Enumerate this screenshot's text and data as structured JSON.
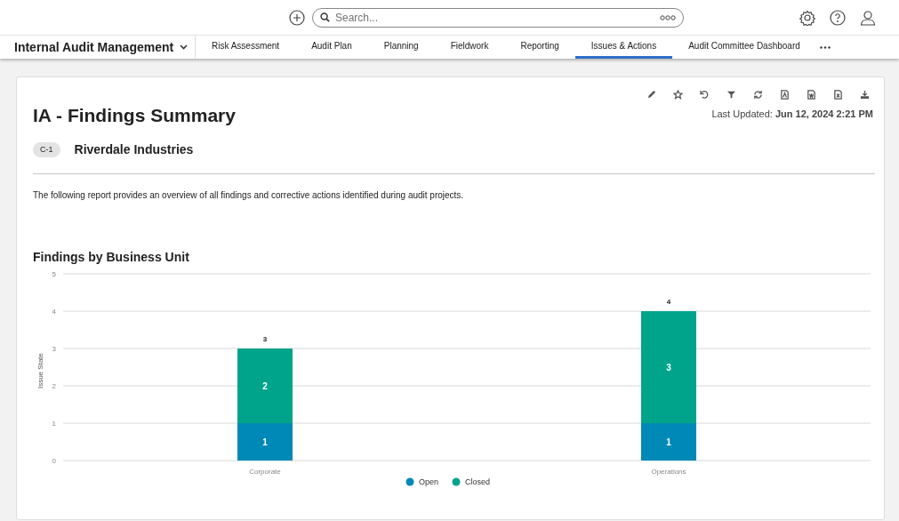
{
  "search": {
    "placeholder": "Search..."
  },
  "app": {
    "title": "Internal Audit Management"
  },
  "tabs": [
    {
      "label": "Risk Assessment",
      "selected": false
    },
    {
      "label": "Audit Plan",
      "selected": false
    },
    {
      "label": "Planning",
      "selected": false
    },
    {
      "label": "Fieldwork",
      "selected": false
    },
    {
      "label": "Reporting",
      "selected": false
    },
    {
      "label": "Issues & Actions",
      "selected": true
    },
    {
      "label": "Audit Committee Dashboard",
      "selected": false
    }
  ],
  "report": {
    "title": "IA - Findings Summary",
    "last_updated_label": "Last Updated:",
    "last_updated_value": "Jun 12, 2024 2:21 PM",
    "badge": "C-1",
    "entity": "Riverdale Industries",
    "description": "The following report provides an overview of all findings and corrective actions identified during audit projects."
  },
  "chart": {
    "chart_data": {
      "type": "bar",
      "title": "Findings by Business Unit",
      "ylabel": "Issue State",
      "categories": [
        "Corporate",
        "Operations"
      ],
      "stacked": true,
      "grid": true,
      "legend": true,
      "data_labels": true,
      "ylim": [
        0,
        5
      ],
      "yticks": [
        0,
        1,
        2,
        3,
        4,
        5
      ],
      "series": [
        {
          "name": "Open",
          "color": "#0089b7",
          "values": [
            1,
            1
          ]
        },
        {
          "name": "Closed",
          "color": "#00a48b",
          "values": [
            2,
            3
          ]
        }
      ],
      "annotations": [
        "3",
        "4"
      ]
    }
  }
}
